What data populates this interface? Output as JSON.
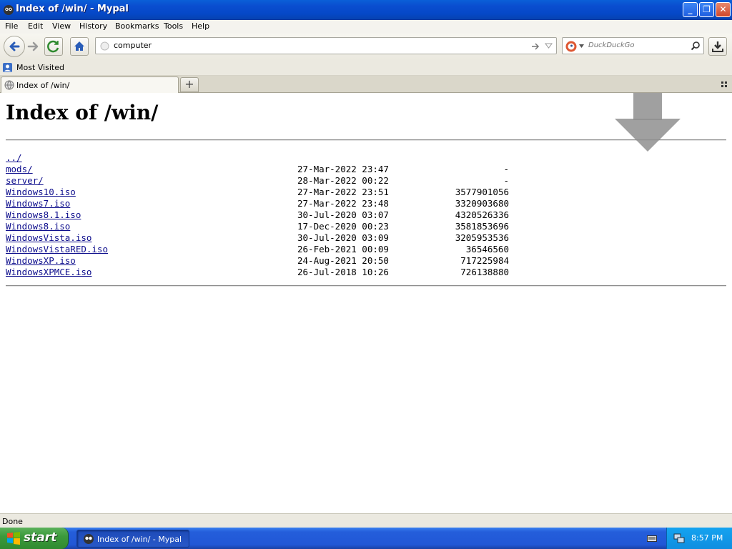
{
  "window": {
    "title": "Index of /win/ - Mypal",
    "minimize": "_",
    "restore": "❐",
    "close": "✕"
  },
  "menu": [
    "File",
    "Edit",
    "View",
    "History",
    "Bookmarks",
    "Tools",
    "Help"
  ],
  "navbar": {
    "url": "computer",
    "search_placeholder": "DuckDuckGo"
  },
  "bookmarks": {
    "most_visited": "Most Visited"
  },
  "tabs": [
    {
      "label": "Index of /win/"
    }
  ],
  "new_tab": "+",
  "page": {
    "heading": "Index of /win/",
    "entries": [
      {
        "name": "../",
        "date": "",
        "size": ""
      },
      {
        "name": "mods/",
        "date": "27-Mar-2022 23:47",
        "size": "-"
      },
      {
        "name": "server/",
        "date": "28-Mar-2022 00:22",
        "size": "-"
      },
      {
        "name": "Windows10.iso",
        "date": "27-Mar-2022 23:51",
        "size": "3577901056"
      },
      {
        "name": "Windows7.iso",
        "date": "27-Mar-2022 23:48",
        "size": "3320903680"
      },
      {
        "name": "Windows8.1.iso",
        "date": "30-Jul-2020 03:07",
        "size": "4320526336"
      },
      {
        "name": "Windows8.iso",
        "date": "17-Dec-2020 00:23",
        "size": "3581853696"
      },
      {
        "name": "WindowsVista.iso",
        "date": "30-Jul-2020 03:09",
        "size": "3205953536"
      },
      {
        "name": "WindowsVistaRED.iso",
        "date": "26-Feb-2021 00:09",
        "size": "36546560"
      },
      {
        "name": "WindowsXP.iso",
        "date": "24-Aug-2021 20:50",
        "size": "717225984"
      },
      {
        "name": "WindowsXPMCE.iso",
        "date": "26-Jul-2018 10:26",
        "size": "726138880"
      }
    ]
  },
  "status": {
    "text": "Done"
  },
  "taskbar": {
    "start": "start",
    "task_label": "Index of /win/ - Mypal",
    "clock": "8:57 PM"
  },
  "colors": {
    "link": "#0d0d8c",
    "titlebar": "#0a4ed0",
    "taskbar": "#245edb",
    "start": "#3c9a3c"
  }
}
